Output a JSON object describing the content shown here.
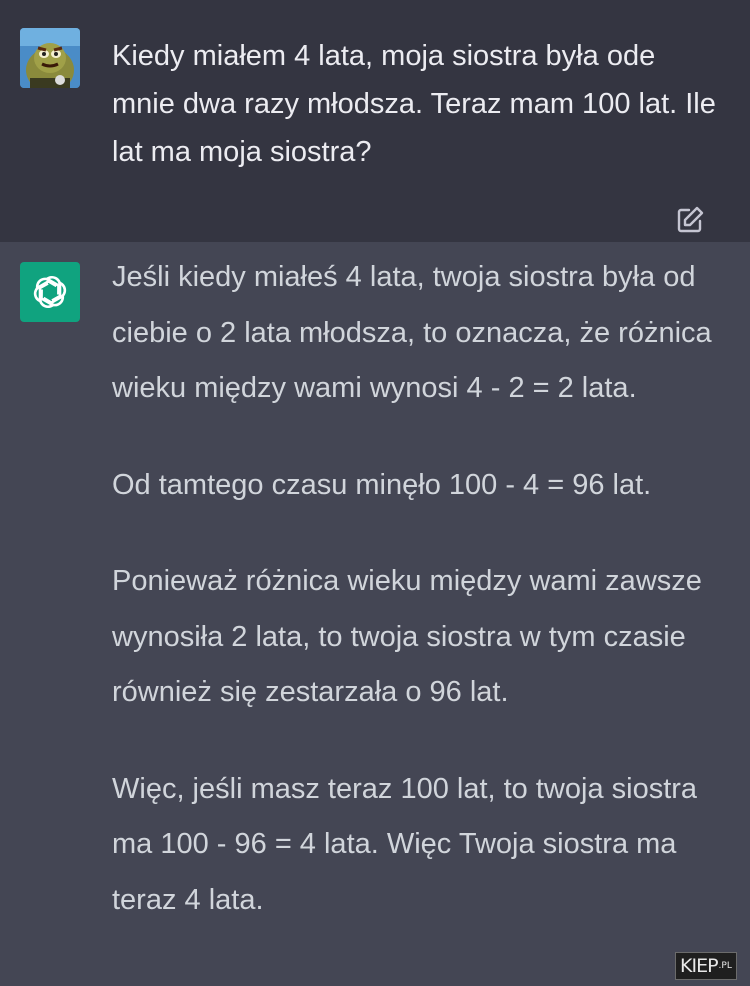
{
  "user_message": {
    "avatar": "cartoon-avatar",
    "text": "Kiedy miałem 4 lata, moja siostra była ode mnie dwa razy młodsza. Teraz mam 100 lat. Ile lat ma moja siostra?",
    "edit_icon": "edit-icon"
  },
  "assistant_message": {
    "avatar": "openai-logo-icon",
    "paragraphs": [
      "Jeśli kiedy miałeś 4 lata, twoja siostra była od ciebie o 2 lata młodsza, to oznacza, że różnica wieku między wami wynosi 4 - 2 = 2 lata.",
      "Od tamtego czasu minęło 100 - 4 = 96 lat.",
      "Ponieważ różnica wieku między wami zawsze wynosiła 2 lata, to twoja siostra w tym czasie również się zestarzała o 96 lat.",
      "Więc, jeśli masz teraz 100 lat, to twoja siostra ma 100 - 96 = 4 lata. Więc Twoja siostra ma teraz 4 lata."
    ]
  },
  "watermark": {
    "main": "KIEP",
    "suffix": ".PL"
  },
  "colors": {
    "user_bg": "#343541",
    "assistant_bg": "#444654",
    "gpt_green": "#10a37f"
  }
}
